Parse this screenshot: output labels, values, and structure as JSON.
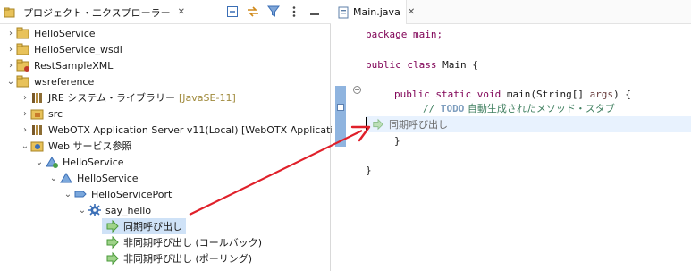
{
  "left_view": {
    "tab_title": "プロジェクト・エクスプローラー",
    "close_glyph": "✕"
  },
  "tree": [
    {
      "label": "HelloService",
      "icon": "project-icon",
      "twisty": "›"
    },
    {
      "label": "HelloService_wsdl",
      "icon": "project-icon",
      "twisty": "›"
    },
    {
      "label": "RestSampleXML",
      "icon": "project-icon",
      "twisty": "›"
    },
    {
      "label": "wsreference",
      "icon": "project-icon",
      "twisty": "⌄"
    },
    {
      "label": "JRE システム・ライブラリー",
      "decoration": "[JavaSE-11]",
      "icon": "library-icon",
      "twisty": "›"
    },
    {
      "label": "src",
      "icon": "source-folder-icon",
      "twisty": "›"
    },
    {
      "label": "WebOTX Application Server v11(Local) [WebOTX Application",
      "icon": "library-icon",
      "twisty": "›"
    },
    {
      "label": "Web サービス参照",
      "icon": "web-service-ref-icon",
      "twisty": "⌄"
    },
    {
      "label": "HelloService",
      "icon": "service-icon",
      "twisty": "⌄"
    },
    {
      "label": "HelloService",
      "icon": "service-triangle-icon",
      "twisty": "⌄"
    },
    {
      "label": "HelloServicePort",
      "icon": "port-icon",
      "twisty": "⌄"
    },
    {
      "label": "say_hello",
      "icon": "operation-gear-icon",
      "twisty": "⌄"
    },
    {
      "label": "同期呼び出し",
      "icon": "invoke-arrow-icon",
      "twisty": ""
    },
    {
      "label": "非同期呼び出し (コールバック)",
      "icon": "invoke-arrow-icon",
      "twisty": ""
    },
    {
      "label": "非同期呼び出し (ポーリング)",
      "icon": "invoke-arrow-icon",
      "twisty": ""
    }
  ],
  "editor": {
    "tab_title": "Main.java",
    "close_glyph": "✕",
    "line1": "package main;",
    "line2_kw": "public class ",
    "line2_rest": "Main {",
    "line3_kw": "public static void ",
    "line3_mid": "main(String[] ",
    "line3_param": "args",
    "line3_end": ") {",
    "line4_prefix": "// ",
    "line4_todo": "TODO",
    "line4_comment": " 自動生成されたメソッド・スタブ",
    "line5": "}",
    "line6": "}",
    "drop_label": "同期呼び出し"
  },
  "colors": {
    "selection": "#cfe2f7",
    "arrow": "#e0202a",
    "keyword": "#7f0055",
    "comment": "#3f7f5f"
  }
}
